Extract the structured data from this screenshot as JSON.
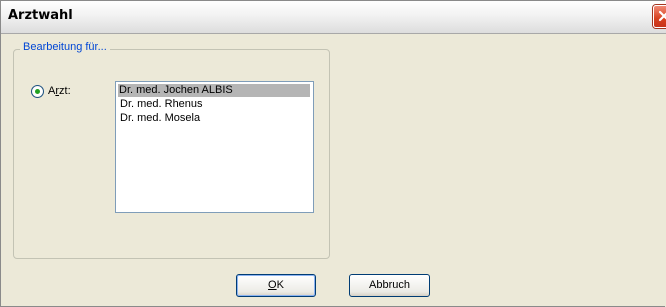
{
  "window": {
    "title": "Arztwahl"
  },
  "group": {
    "legend": "Bearbeitung für...",
    "radio_label_pre": "A",
    "radio_label_accel": "r",
    "radio_label_post": "zt:",
    "radio_checked": true
  },
  "list": {
    "items": [
      "Dr. med. Jochen ALBIS",
      "Dr. med. Rhenus",
      "Dr. med. Mosela"
    ],
    "selected_index": 0
  },
  "buttons": {
    "ok_accel": "O",
    "ok_rest": "K",
    "cancel_label": "Abbruch"
  },
  "icons": {
    "close": "close-icon"
  },
  "colors": {
    "close_red": "#d8411f",
    "legend_blue": "#0046d5",
    "radio_green": "#21a121"
  }
}
